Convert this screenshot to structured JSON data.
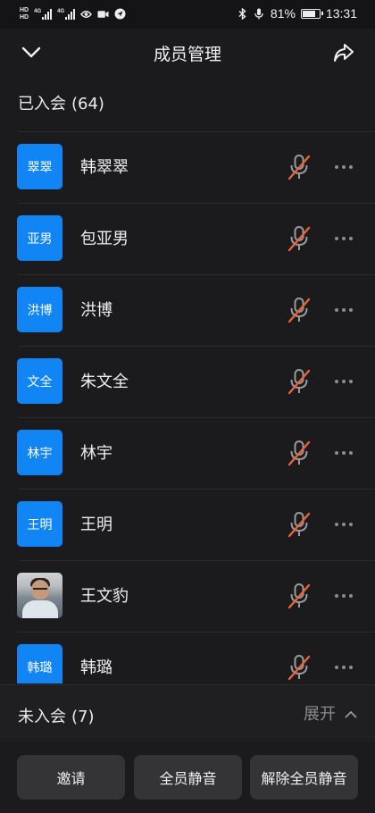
{
  "status_bar": {
    "hd_top": "HD",
    "hd_bottom": "HD",
    "network1": "4G",
    "network2": "4G",
    "battery_text": "81%",
    "battery_level": 0.81,
    "time": "13:31",
    "icons": [
      "eye-icon",
      "video-icon",
      "location-icon",
      "bluetooth-icon",
      "mic-icon",
      "battery-icon"
    ]
  },
  "header": {
    "title": "成员管理",
    "back_icon": "chevron-down-icon",
    "share_icon": "share-icon"
  },
  "joined": {
    "label": "已入会",
    "count": "(64)"
  },
  "members": [
    {
      "avatar_text": "翠翠",
      "name": "韩翠翠",
      "muted": true
    },
    {
      "avatar_text": "亚男",
      "name": "包亚男",
      "muted": true
    },
    {
      "avatar_text": "洪博",
      "name": "洪博",
      "muted": true
    },
    {
      "avatar_text": "文全",
      "name": "朱文全",
      "muted": true
    },
    {
      "avatar_text": "林宇",
      "name": "林宇",
      "muted": true
    },
    {
      "avatar_text": "王明",
      "name": "王明",
      "muted": true
    },
    {
      "avatar_text": "",
      "name": "王文豹",
      "muted": true,
      "photo": true
    },
    {
      "avatar_text": "韩璐",
      "name": "韩璐",
      "muted": true
    }
  ],
  "not_joined": {
    "label": "未入会",
    "count": "(7)",
    "expand_label": "展开"
  },
  "actions": {
    "invite": "邀请",
    "mute_all": "全员静音",
    "unmute_all": "解除全员静音"
  },
  "colors": {
    "background": "#1b1b1d",
    "avatar_blue": "#1185f3",
    "muted_slash": "#e8643a",
    "mic_gray": "#9a9a9d"
  }
}
